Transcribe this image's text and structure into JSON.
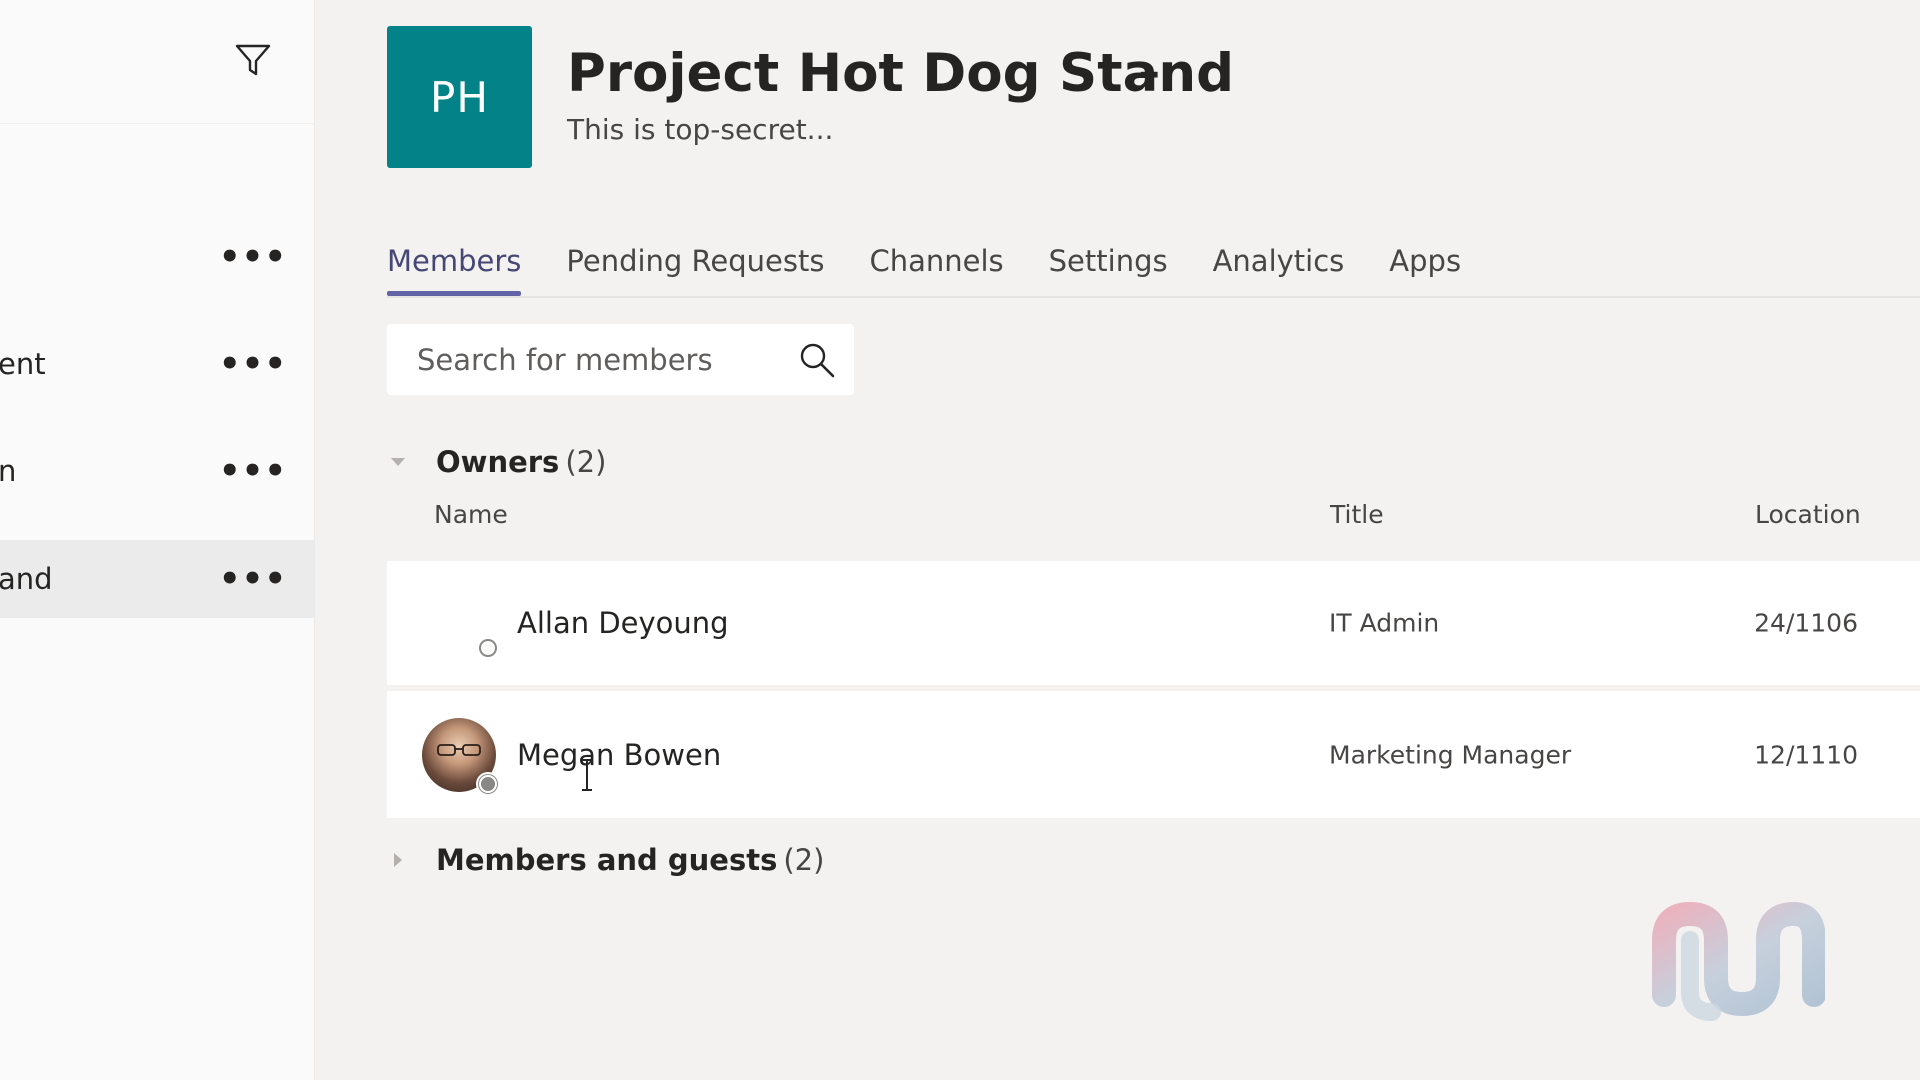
{
  "sidebar": {
    "filter_icon": "filter-icon",
    "teams": [
      {
        "label": "",
        "more": "•••",
        "selected": false
      },
      {
        "label": "ent",
        "more": "•••",
        "selected": false
      },
      {
        "label": "n",
        "more": "•••",
        "selected": false
      },
      {
        "label": "and",
        "more": "•••",
        "selected": true
      }
    ]
  },
  "team": {
    "avatar_initials": "PH",
    "avatar_color": "#038387",
    "name": "Project Hot Dog Stand",
    "more": "···",
    "description": "This is top-secret..."
  },
  "tabs": [
    {
      "label": "Members",
      "active": true
    },
    {
      "label": "Pending Requests",
      "active": false
    },
    {
      "label": "Channels",
      "active": false
    },
    {
      "label": "Settings",
      "active": false
    },
    {
      "label": "Analytics",
      "active": false
    },
    {
      "label": "Apps",
      "active": false
    }
  ],
  "search": {
    "placeholder": "Search for members",
    "value": ""
  },
  "owners": {
    "title": "Owners",
    "count": "(2)",
    "expanded": true,
    "columns": {
      "name": "Name",
      "title": "Title",
      "location": "Location"
    },
    "rows": [
      {
        "name": "Allan Deyoung",
        "title": "IT Admin",
        "location": "24/1106",
        "avatar": "none",
        "presence": "offline-ring"
      },
      {
        "name": "Megan Bowen",
        "title": "Marketing Manager",
        "location": "12/1110",
        "avatar": "photo",
        "presence": "offline"
      }
    ]
  },
  "members_guests": {
    "title": "Members and guests",
    "count": "(2)",
    "expanded": false
  },
  "colors": {
    "accent": "#6264a7",
    "background": "#f3f2f1",
    "row_background": "#ffffff"
  }
}
